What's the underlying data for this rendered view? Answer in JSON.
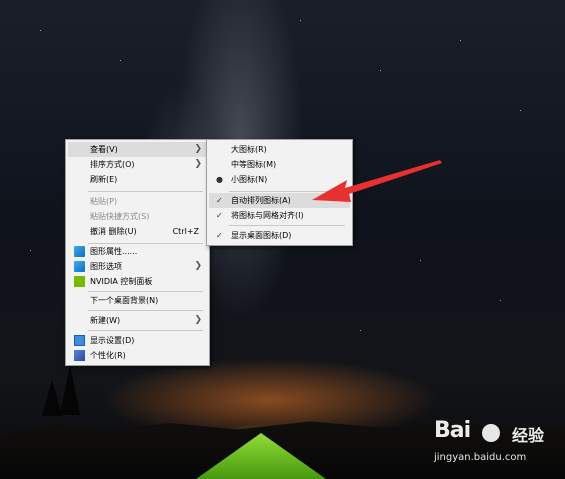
{
  "main_menu": {
    "items": [
      {
        "label": "查看(V)",
        "submenu": true
      },
      {
        "label": "排序方式(O)",
        "submenu": true
      },
      {
        "label": "刷新(E)"
      },
      {
        "label": "粘贴(P)",
        "disabled": true
      },
      {
        "label": "粘贴快捷方式(S)",
        "disabled": true
      },
      {
        "label": "撤消 删除(U)",
        "shortcut": "Ctrl+Z"
      },
      {
        "label": "图形属性......",
        "icon": "graphics-icon"
      },
      {
        "label": "图形选项",
        "icon": "graphics-icon",
        "submenu": true
      },
      {
        "label": "NVIDIA 控制面板",
        "icon": "nvidia-icon"
      },
      {
        "label": "下一个桌面背景(N)"
      },
      {
        "label": "新建(W)",
        "submenu": true
      },
      {
        "label": "显示设置(D)",
        "icon": "display-icon"
      },
      {
        "label": "个性化(R)",
        "icon": "personalize-icon"
      }
    ]
  },
  "view_submenu": {
    "items": [
      {
        "label": "大图标(R)"
      },
      {
        "label": "中等图标(M)"
      },
      {
        "label": "小图标(N)",
        "mark": "bullet"
      },
      {
        "label": "自动排列图标(A)",
        "mark": "check",
        "highlighted": true
      },
      {
        "label": "将图标与网格对齐(I)",
        "mark": "check"
      },
      {
        "label": "显示桌面图标(D)",
        "mark": "check"
      }
    ]
  },
  "watermark": {
    "logo": "Bai",
    "logo_suffix": "经验",
    "url": "jingyan.baidu.com"
  },
  "colors": {
    "menu_bg": "#f2f2f2",
    "highlight": "#dcdcdc",
    "annotation_arrow": "#e8312f"
  }
}
